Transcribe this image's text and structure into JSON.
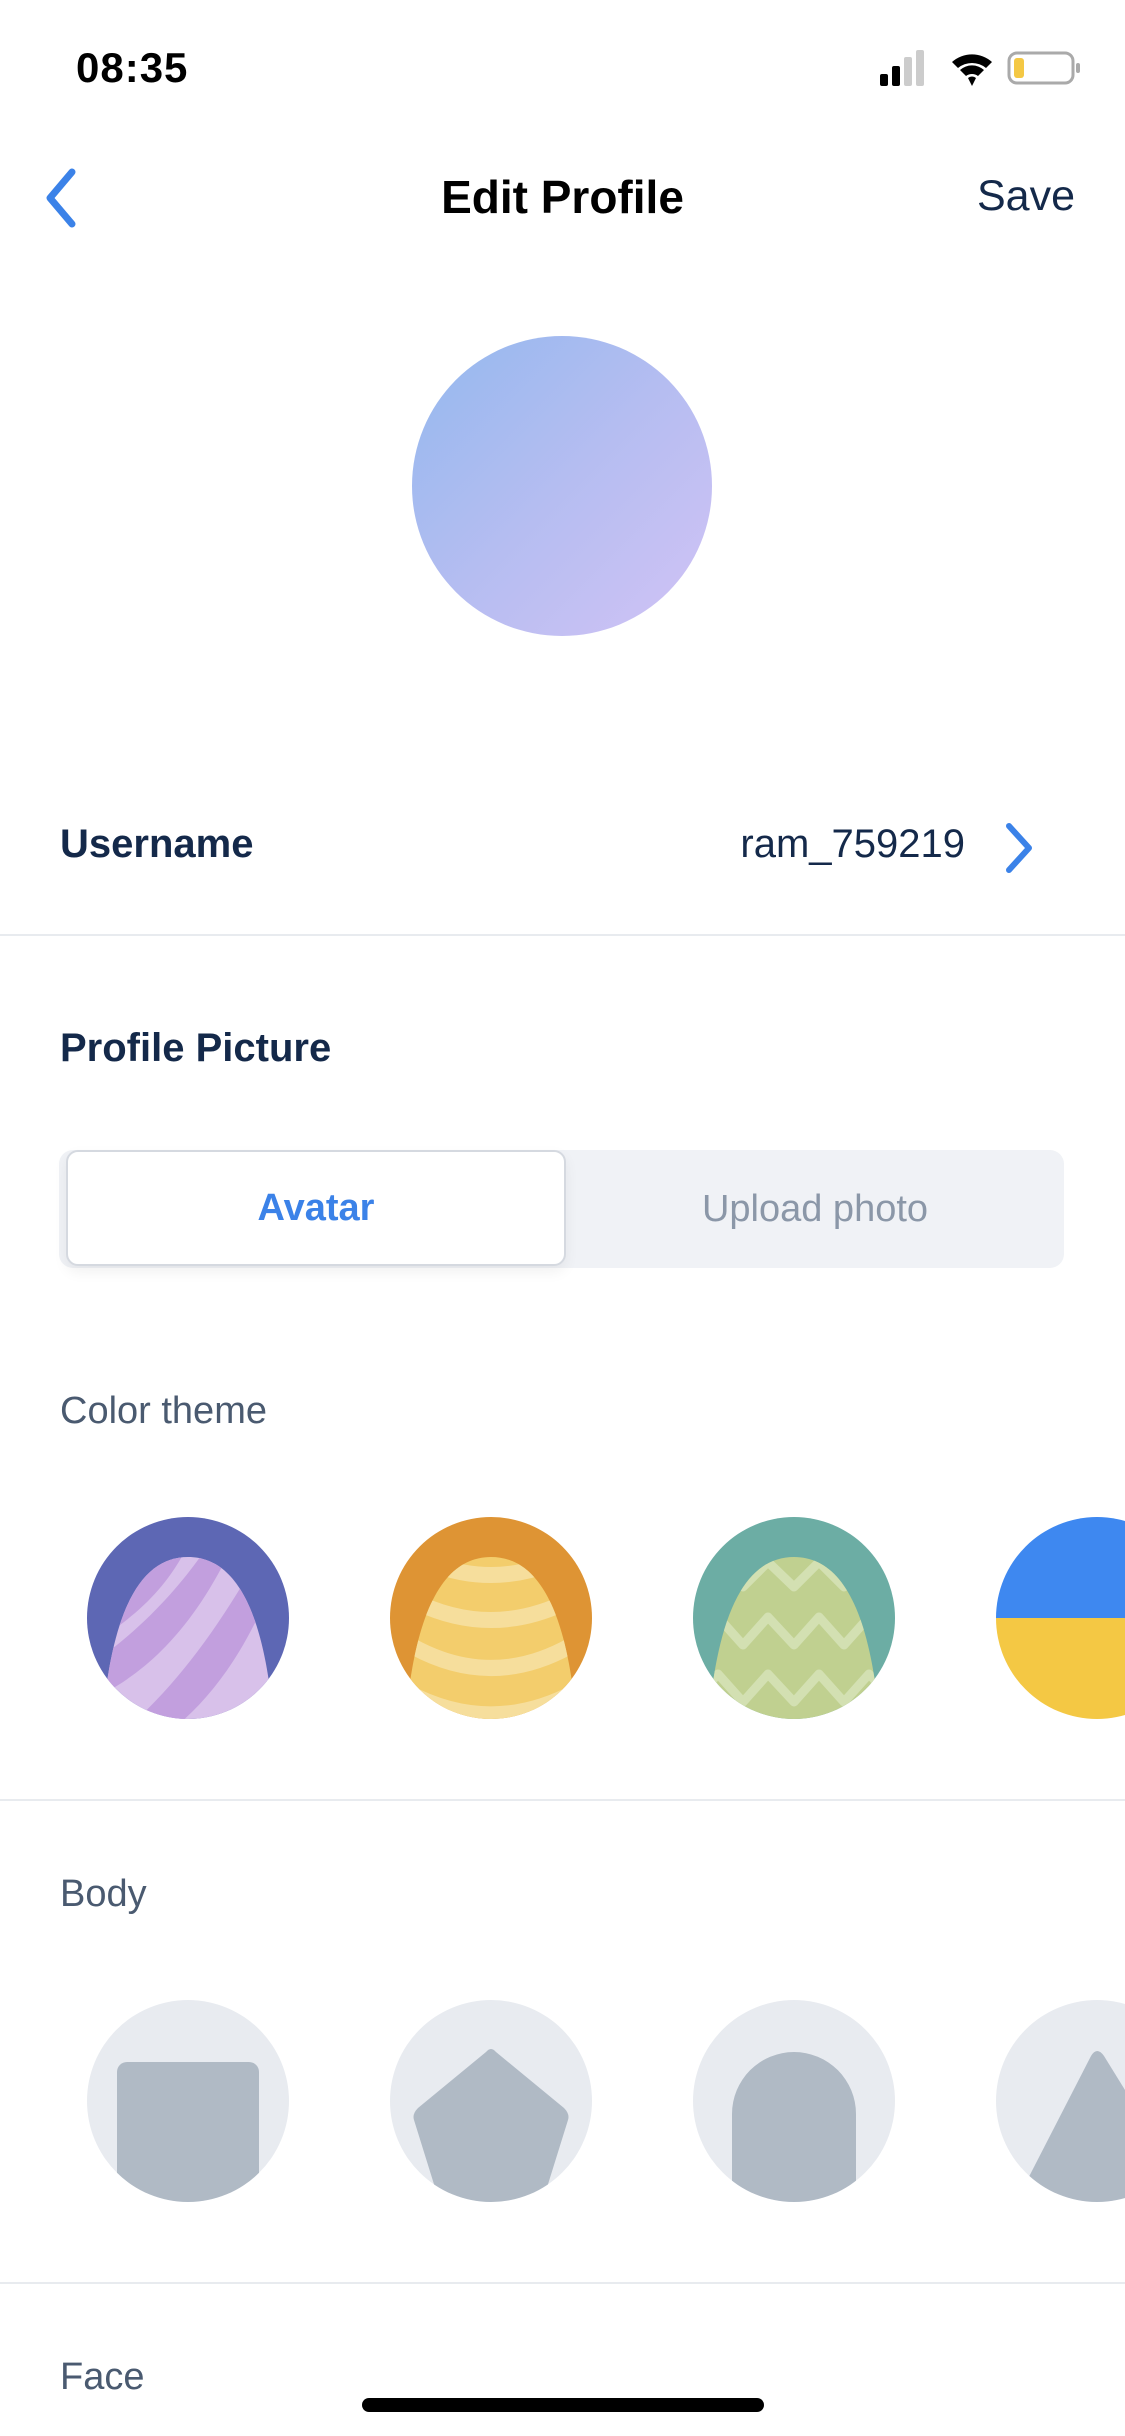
{
  "status_bar": {
    "time": "08:35",
    "icons": [
      "signal-icon",
      "wifi-icon",
      "battery-icon"
    ]
  },
  "nav": {
    "title": "Edit Profile",
    "save_label": "Save",
    "back_icon": "chevron-left-icon"
  },
  "username": {
    "label": "Username",
    "value": "ram_759219"
  },
  "profile_picture": {
    "heading": "Profile Picture",
    "tabs": [
      {
        "label": "Avatar",
        "selected": true
      },
      {
        "label": "Upload photo",
        "selected": false
      }
    ]
  },
  "color_theme": {
    "label": "Color theme",
    "options": [
      {
        "name": "purple",
        "bg": "#5d67b4",
        "fg": "#d8c1ea",
        "stripe": "#c29fde"
      },
      {
        "name": "orange",
        "bg": "#de9434",
        "fg": "#f3cd6c",
        "stripe": "#f6de9c"
      },
      {
        "name": "teal",
        "bg": "#6cada4",
        "fg": "#c0d090",
        "stripe": "#d3e0b2"
      },
      {
        "name": "blue-yellow",
        "bg": "#3e88f0",
        "fg": "#f4c844"
      }
    ]
  },
  "body": {
    "label": "Body",
    "options": [
      "square",
      "pentagon",
      "arch",
      "triangle"
    ]
  },
  "face": {
    "label": "Face"
  }
}
